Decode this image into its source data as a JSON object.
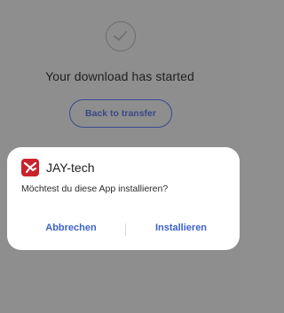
{
  "download": {
    "title": "Your download has started",
    "back_button": "Back to transfer"
  },
  "dialog": {
    "app_name": "JAY-tech",
    "app_icon": "jaytech-app-icon",
    "question": "Möchtest du diese App installieren?",
    "cancel_label": "Abbrechen",
    "install_label": "Installieren"
  },
  "colors": {
    "overlay": "#8e8e8e",
    "accent": "#3b63c7",
    "button_border": "#3b4a8e",
    "app_icon_bg": "#c9232c"
  }
}
